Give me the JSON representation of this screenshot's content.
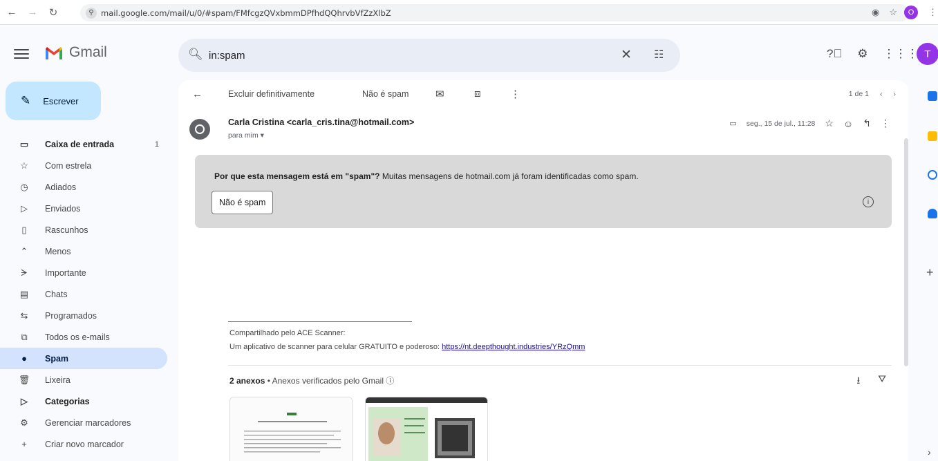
{
  "browser": {
    "url": "mail.google.com/mail/u/0/#spam/FMfcgzQVxbmmDPfhdQQhrvbVfZzXlbZ",
    "profile_initial": "O"
  },
  "gmail": {
    "brand": "Gmail",
    "search_value": "in:spam",
    "avatar_initial": "T"
  },
  "sidebar": {
    "compose": "Escrever",
    "items": [
      {
        "label": "Caixa de entrada",
        "count": "1"
      },
      {
        "label": "Com estrela"
      },
      {
        "label": "Adiados"
      },
      {
        "label": "Enviados"
      },
      {
        "label": "Rascunhos"
      },
      {
        "label": "Menos"
      },
      {
        "label": "Importante"
      },
      {
        "label": "Chats"
      },
      {
        "label": "Programados"
      },
      {
        "label": "Todos os e-mails"
      },
      {
        "label": "Spam"
      },
      {
        "label": "Lixeira"
      },
      {
        "label": "Categorias"
      },
      {
        "label": "Gerenciar marcadores"
      },
      {
        "label": "Criar novo marcador"
      }
    ]
  },
  "toolbar": {
    "delete_forever": "Excluir definitivamente",
    "not_spam": "Não é spam",
    "pager": "1 de 1"
  },
  "message": {
    "sender": "Carla Cristina <carla_cris.tina@hotmail.com>",
    "to": "para mim",
    "date": "seg., 15 de jul., 11:28",
    "warning_bold": "Por que esta mensagem está em \"spam\"?",
    "warning_rest": " Muitas mensagens de hotmail.com já foram identificadas como spam.",
    "not_spam_button": "Não é spam",
    "sig_line1": "Compartilhado pelo ACE Scanner:",
    "sig_line2": "Um aplicativo de scanner para celular GRATUITO e poderoso: ",
    "sig_link": "https://nt.deepthought.industries/YRzQmm",
    "attachments_count": "2 anexos",
    "attachments_note": " • Anexos verificados pelo Gmail"
  }
}
